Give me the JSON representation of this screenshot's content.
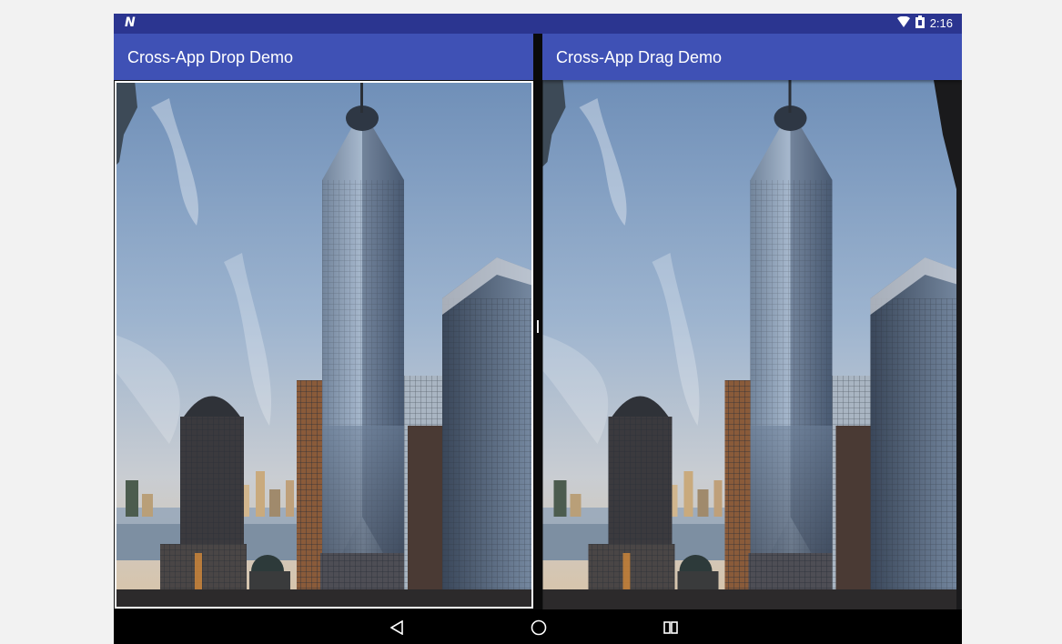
{
  "status_bar": {
    "notification_icon": "n-icon",
    "wifi_icon": "wifi-icon",
    "battery_icon": "battery-icon",
    "time": "2:16"
  },
  "left_app": {
    "title": "Cross-App Drop Demo",
    "toolbar_color": "#3f51b5"
  },
  "right_app": {
    "title": "Cross-App Drag Demo",
    "toolbar_color": "#3f51b5"
  },
  "images": {
    "subject": "skyscraper photo"
  },
  "nav": {
    "back_icon": "back-triangle-icon",
    "home_icon": "home-circle-icon",
    "recents_icon": "recents-square-icon"
  },
  "colors": {
    "status_bar": "#2b3590",
    "drop_target_border": "#ffffff"
  }
}
